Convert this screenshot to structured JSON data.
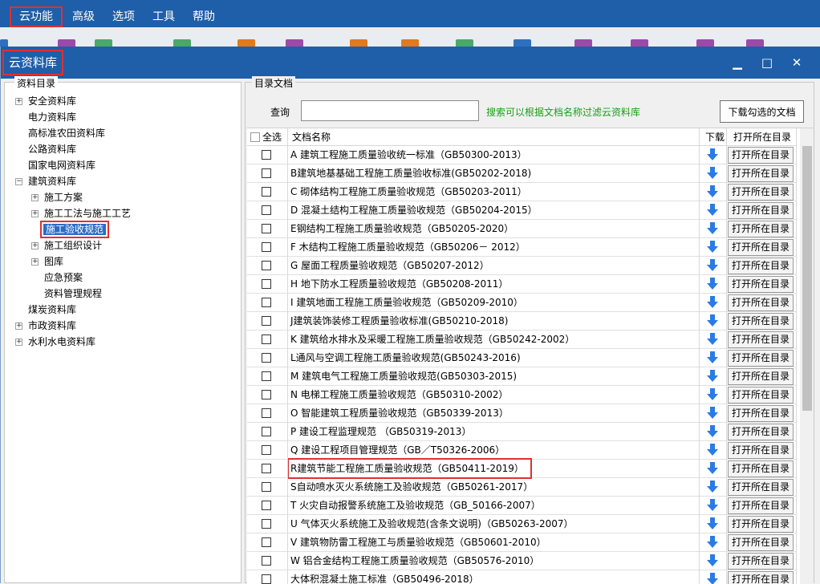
{
  "menubar": {
    "items": [
      {
        "label": "云功能"
      },
      {
        "label": "高级"
      },
      {
        "label": "选项"
      },
      {
        "label": "工具"
      },
      {
        "label": "帮助"
      }
    ]
  },
  "dialog": {
    "title": "云资料库",
    "minimize": "▁",
    "maximize": "□",
    "close": "✕"
  },
  "left": {
    "group_title": "资料目录",
    "tree": [
      {
        "label": "安全资料库",
        "expander": "+"
      },
      {
        "label": "电力资料库",
        "expander": ""
      },
      {
        "label": "高标准农田资料库",
        "expander": ""
      },
      {
        "label": "公路资料库",
        "expander": ""
      },
      {
        "label": "国家电网资料库",
        "expander": ""
      },
      {
        "label": "建筑资料库",
        "expander": "−"
      },
      {
        "label": "施工方案",
        "expander": "+"
      },
      {
        "label": "施工工法与施工工艺",
        "expander": "+"
      },
      {
        "label": "施工验收规范",
        "expander": ""
      },
      {
        "label": "施工组织设计",
        "expander": "+"
      },
      {
        "label": "图库",
        "expander": "+"
      },
      {
        "label": "应急预案",
        "expander": ""
      },
      {
        "label": "资料管理规程",
        "expander": ""
      },
      {
        "label": "煤炭资料库",
        "expander": ""
      },
      {
        "label": "市政资料库",
        "expander": "+"
      },
      {
        "label": "水利水电资料库",
        "expander": "+"
      }
    ]
  },
  "right": {
    "group_title": "目录文档",
    "query_label": "查询",
    "query_value": "",
    "query_hint": "搜索可以根据文档名称过滤云资料库",
    "download_checked_label": "下载勾选的文档",
    "columns": {
      "select_all": "全选",
      "name": "文档名称",
      "download": "下载",
      "open": "打开所在目录"
    },
    "open_button_label": "打开所在目录",
    "colors": {
      "accent": "#1f5ea8",
      "highlight_box": "#e03030",
      "hint": "#18a018",
      "download_icon": "#2b7be4"
    },
    "rows": [
      {
        "name": "A 建筑工程施工质量验收统一标准（GB50300-2013）"
      },
      {
        "name": "B建筑地基基础工程施工质量验收标准(GB50202-2018)"
      },
      {
        "name": "C 砌体结构工程施工质量验收规范（GB50203-2011）"
      },
      {
        "name": "D 混凝土结构工程施工质量验收规范（GB50204-2015）"
      },
      {
        "name": "E钢结构工程施工质量验收规范（GB50205-2020）"
      },
      {
        "name": "F 木结构工程施工质量验收规范（GB50206－ 2012）"
      },
      {
        "name": "G 屋面工程质量验收规范（GB50207-2012）"
      },
      {
        "name": "H 地下防水工程质量验收规范（GB50208-2011）"
      },
      {
        "name": "I 建筑地面工程施工质量验收规范（GB50209-2010）"
      },
      {
        "name": "J建筑装饰装修工程质量验收标准(GB50210-2018)"
      },
      {
        "name": "K 建筑给水排水及采暖工程施工质量验收规范（GB50242-2002）"
      },
      {
        "name": "L通风与空调工程施工质量验收规范(GB50243-2016)"
      },
      {
        "name": "M 建筑电气工程施工质量验收规范(GB50303-2015)"
      },
      {
        "name": "N 电梯工程施工质量验收规范（GB50310-2002）"
      },
      {
        "name": "O 智能建筑工程质量验收规范（GB50339-2013）"
      },
      {
        "name": "P 建设工程监理规范 （GB50319-2013）"
      },
      {
        "name": "Q 建设工程项目管理规范（GB／T50326-2006）"
      },
      {
        "name": "R建筑节能工程施工质量验收规范（GB50411-2019）"
      },
      {
        "name": "S自动喷水灭火系统施工及验收规范（GB50261-2017）"
      },
      {
        "name": "T 火灾自动报警系统施工及验收规范（GB_50166-2007）"
      },
      {
        "name": "U 气体灭火系统施工及验收规范(含条文说明)（GB50263-2007）"
      },
      {
        "name": "V 建筑物防雷工程施工与质量验收规范（GB50601-2010）"
      },
      {
        "name": "W 铝合金结构工程施工质量验收规范（GB50576-2010）"
      },
      {
        "name": "大体积混凝土施工标准（GB50496-2018）"
      }
    ]
  }
}
